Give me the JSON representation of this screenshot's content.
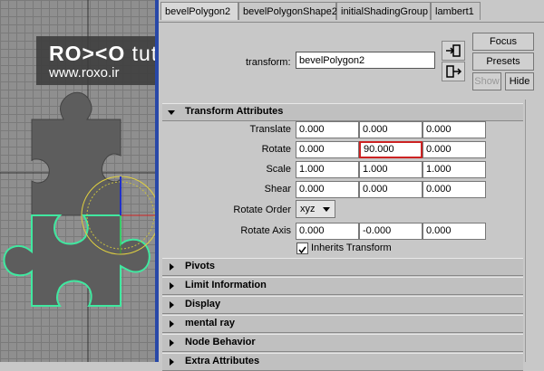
{
  "logo": {
    "brand_left": "RO",
    "brand_mid": "><",
    "brand_right": "O",
    "suffix": "tuts",
    "url": "www.roxo.ir"
  },
  "tabs": [
    "bevelPolygon2",
    "bevelPolygonShape2",
    "initialShadingGroup",
    "lambert1"
  ],
  "header": {
    "transform_label": "transform:",
    "transform_value": "bevelPolygon2",
    "focus_label": "Focus",
    "presets_label": "Presets",
    "show_label": "Show",
    "hide_label": "Hide"
  },
  "transform_attributes": {
    "title": "Transform Attributes",
    "translate": {
      "label": "Translate",
      "x": "0.000",
      "y": "0.000",
      "z": "0.000"
    },
    "rotate": {
      "label": "Rotate",
      "x": "0.000",
      "y": "90.000",
      "z": "0.000"
    },
    "scale": {
      "label": "Scale",
      "x": "1.000",
      "y": "1.000",
      "z": "1.000"
    },
    "shear": {
      "label": "Shear",
      "x": "0.000",
      "y": "0.000",
      "z": "0.000"
    },
    "rotate_order": {
      "label": "Rotate Order",
      "value": "xyz"
    },
    "rotate_axis": {
      "label": "Rotate Axis",
      "x": "0.000",
      "y": "-0.000",
      "z": "0.000"
    },
    "inherits": {
      "label": "Inherits Transform",
      "checked": true
    }
  },
  "sections": [
    "Pivots",
    "Limit Information",
    "Display",
    "mental ray",
    "Node Behavior",
    "Extra Attributes"
  ],
  "colors": {
    "viewport_border": "#2848a8",
    "highlight": "#cc2222",
    "selection": "#40e8a0"
  }
}
